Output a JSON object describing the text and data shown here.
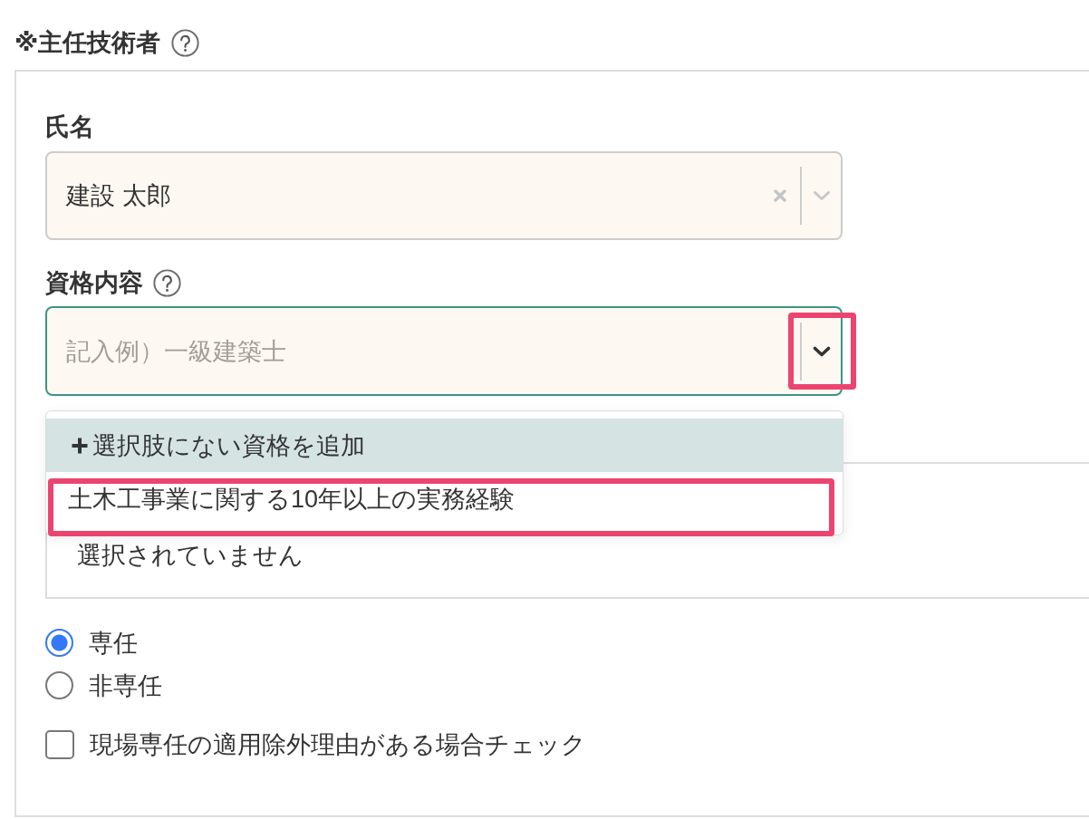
{
  "section": {
    "title": "※主任技術者"
  },
  "name_field": {
    "label": "氏名",
    "value": "建設 太郎",
    "focused": false
  },
  "qualification_field": {
    "label": "資格内容",
    "placeholder": "記入例）一級建築士",
    "focused": true,
    "menu_open": true,
    "toggle_highlighted": true,
    "options": [
      {
        "kind": "add",
        "label": "選択肢にない資格を追加",
        "selected": true,
        "highlighted": false
      },
      {
        "kind": "option",
        "label": "土木工事業に関する10年以上の実務経験",
        "selected": false,
        "highlighted": true
      }
    ]
  },
  "selection_box": {
    "text": "選択されていません"
  },
  "assignment": {
    "options": [
      {
        "label": "専任",
        "selected": true
      },
      {
        "label": "非専任",
        "selected": false
      }
    ]
  },
  "exemption": {
    "label": "現場専任の適用除外理由がある場合チェック",
    "checked": false
  }
}
